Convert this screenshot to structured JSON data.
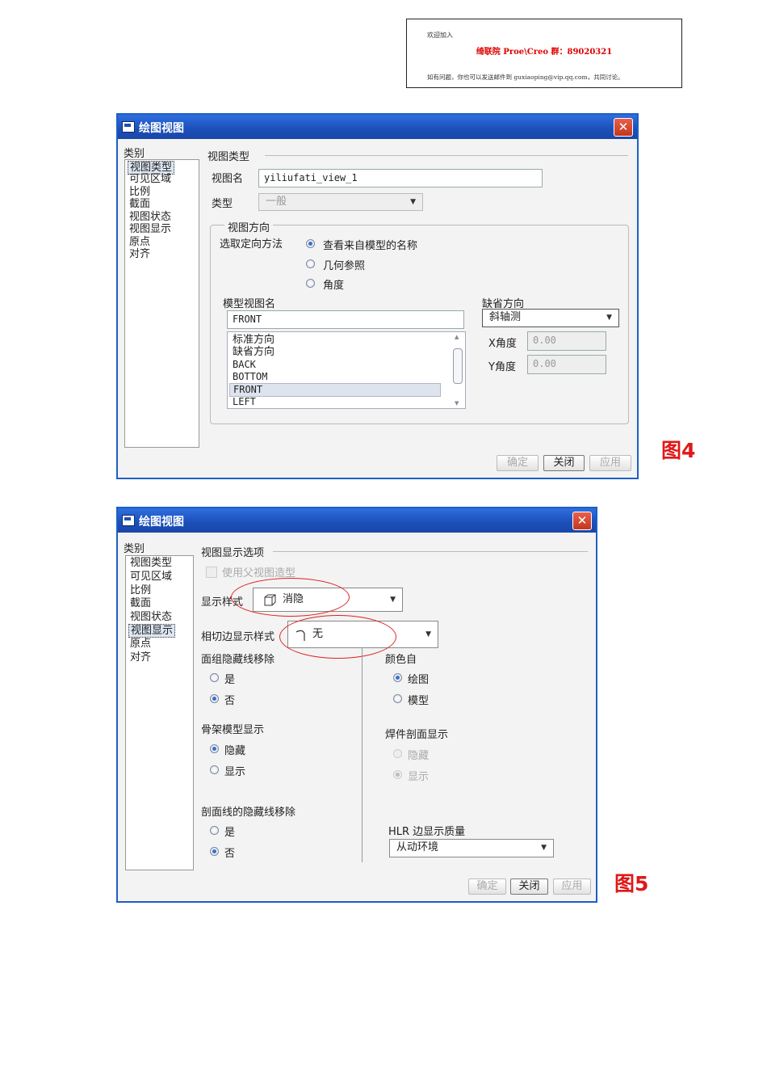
{
  "banner": {
    "line1": "欢迎加入",
    "line2": "绮联院 Proe\\Creo 群：89020321",
    "line3": "如有问题，你也可以发送邮件到 guxiaoping@vip.qq.com，共同讨论。"
  },
  "fig4": {
    "title": "绘图视图",
    "close_glyph": "✕",
    "category_label": "类别",
    "categories": [
      "视图类型",
      "可见区域",
      "比例",
      "截面",
      "视图状态",
      "视图显示",
      "原点",
      "对齐"
    ],
    "section_title": "视图类型",
    "view_name_label": "视图名",
    "view_name_value": "yiliufati_view_1",
    "type_label": "类型",
    "type_value": "一般",
    "orientation_group": "视图方向",
    "orientation_method_label": "选取定向方法",
    "orientation_options": [
      "查看来自模型的名称",
      "几何参照",
      "角度"
    ],
    "model_view_name_label": "模型视图名",
    "model_view_name_value": "FRONT",
    "model_views": [
      "标准方向",
      "缺省方向",
      "BACK",
      "BOTTOM",
      "FRONT",
      "LEFT"
    ],
    "default_orientation_label": "缺省方向",
    "default_orientation_value": "斜轴测",
    "x_angle_label": "X角度",
    "x_angle_value": "0.00",
    "y_angle_label": "Y角度",
    "y_angle_value": "0.00",
    "buttons": {
      "ok": "确定",
      "close": "关闭",
      "apply": "应用"
    },
    "figure_label": "图4"
  },
  "fig5": {
    "title": "绘图视图",
    "close_glyph": "✕",
    "category_label": "类别",
    "categories": [
      "视图类型",
      "可见区域",
      "比例",
      "截面",
      "视图状态",
      "视图显示",
      "原点",
      "对齐"
    ],
    "section_title": "视图显示选项",
    "use_parent_label": "使用父视图造型",
    "display_style_label": "显示样式",
    "display_style_value": "消隐",
    "tangent_edge_label": "相切边显示样式",
    "tangent_edge_value": "无",
    "face_group_label": "面组隐藏线移除",
    "face_group_options": [
      "是",
      "否"
    ],
    "skeleton_label": "骨架模型显示",
    "skeleton_options": [
      "隐藏",
      "显示"
    ],
    "section_hidden_label": "剖面线的隐藏线移除",
    "section_hidden_options": [
      "是",
      "否"
    ],
    "color_from_label": "颜色自",
    "color_from_options": [
      "绘图",
      "模型"
    ],
    "weld_label": "焊件剖面显示",
    "weld_options": [
      "隐藏",
      "显示"
    ],
    "hlr_label": "HLR 边显示质量",
    "hlr_value": "从动环境",
    "buttons": {
      "ok": "确定",
      "close": "关闭",
      "apply": "应用"
    },
    "figure_label": "图5"
  }
}
